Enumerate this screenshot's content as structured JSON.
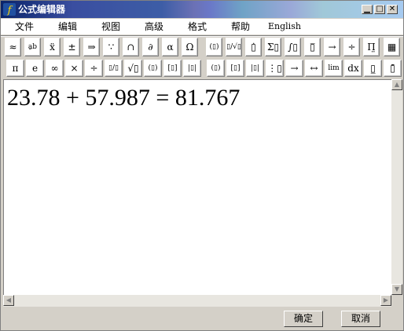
{
  "window": {
    "title": "公式编辑器"
  },
  "menu": [
    "文件",
    "编辑",
    "视图",
    "高级",
    "格式",
    "帮助",
    "English"
  ],
  "toolbar1": [
    {
      "name": "approx-symbols-button",
      "glyph": "≈"
    },
    {
      "name": "spacing-button",
      "glyph": "a̱b"
    },
    {
      "name": "embellishment-button",
      "glyph": "ẍ"
    },
    {
      "name": "operator-button",
      "glyph": "±"
    },
    {
      "name": "arrow-button",
      "glyph": "⇒"
    },
    {
      "name": "logic-button",
      "glyph": "∵"
    },
    {
      "name": "set-button",
      "glyph": "∩"
    },
    {
      "name": "misc-button",
      "glyph": "∂"
    },
    {
      "name": "greek-lower-button",
      "glyph": "α"
    },
    {
      "name": "greek-upper-button",
      "glyph": "Ω"
    },
    {
      "name": "fence-template-button",
      "glyph": "(▯)"
    },
    {
      "name": "fraction-radical-button",
      "glyph": "▯/√▯"
    },
    {
      "name": "subscript-template-button",
      "glyph": "▯̇"
    },
    {
      "name": "summation-template-button",
      "glyph": "Σ▯"
    },
    {
      "name": "integral-template-button",
      "glyph": "∫▯"
    },
    {
      "name": "underbar-template-button",
      "glyph": "▯̅"
    },
    {
      "name": "labeled-arrow-button",
      "glyph": "→"
    },
    {
      "name": "division-template-button",
      "glyph": "÷"
    },
    {
      "name": "product-template-button",
      "glyph": "Π̤"
    },
    {
      "name": "matrix-template-button",
      "glyph": "▦"
    },
    {
      "name": "box-template-button",
      "glyph": "▯"
    }
  ],
  "toolbar2": [
    {
      "name": "pi-button",
      "glyph": "π"
    },
    {
      "name": "e-button",
      "glyph": "e"
    },
    {
      "name": "infinity-button",
      "glyph": "∞"
    },
    {
      "name": "times-button",
      "glyph": "×"
    },
    {
      "name": "divide-button",
      "glyph": "÷"
    },
    {
      "name": "fraction-button",
      "glyph": "▯/▯"
    },
    {
      "name": "sqrt-button",
      "glyph": "√▯"
    },
    {
      "name": "parentheses-button",
      "glyph": "(▯)"
    },
    {
      "name": "brackets-button",
      "glyph": "[▯]"
    },
    {
      "name": "abs-button",
      "glyph": "|▯|"
    },
    {
      "name": "paren-template-button",
      "glyph": "(▯)"
    },
    {
      "name": "bracket-template-button",
      "glyph": "[▯]"
    },
    {
      "name": "bar-template-button",
      "glyph": "|▯|"
    },
    {
      "name": "matrix-small-button",
      "glyph": "⋮▯"
    },
    {
      "name": "right-arrow-button",
      "glyph": "→"
    },
    {
      "name": "double-arrow-button",
      "glyph": "↔"
    },
    {
      "name": "limit-button",
      "glyph": "lim"
    },
    {
      "name": "dx-button",
      "glyph": "dx"
    },
    {
      "name": "subsup-button",
      "glyph": "▯̲"
    },
    {
      "name": "overbar-button",
      "glyph": "▯̄"
    }
  ],
  "formula": "23.78 + 57.987 = 81.767",
  "buttons": {
    "ok": "确定",
    "cancel": "取消"
  }
}
